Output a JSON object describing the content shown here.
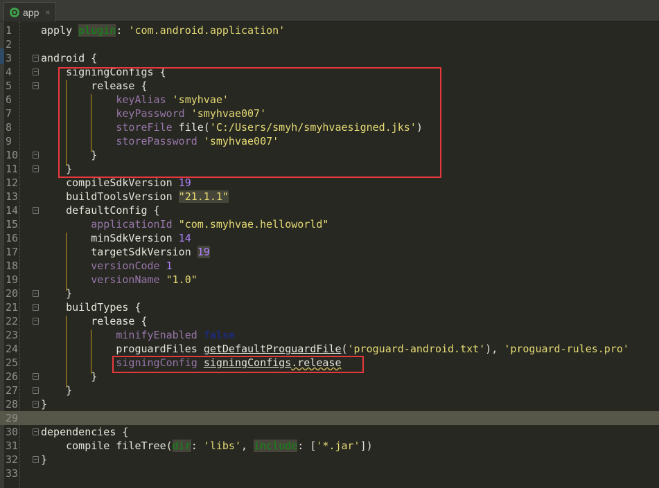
{
  "tab": {
    "label": "app",
    "close": "×",
    "icon": "android-module-icon"
  },
  "colors": {
    "background": "#272822",
    "highlight": "#e8383d",
    "string": "#e6db74",
    "property": "#9876aa",
    "number": "#ae81ff",
    "keyword_arg": "#0f8a16"
  },
  "current_line": 29,
  "code": {
    "lines": [
      {
        "n": "1",
        "fold": false,
        "tokens": [
          {
            "t": "apply "
          },
          {
            "t": "plugin",
            "c": "g bg"
          },
          {
            "t": ": "
          },
          {
            "t": "'com.android.application'",
            "c": "s"
          }
        ]
      },
      {
        "n": "2",
        "fold": false,
        "tokens": []
      },
      {
        "n": "3",
        "fold": true,
        "tokens": [
          {
            "t": "android {"
          }
        ]
      },
      {
        "n": "4",
        "fold": true,
        "tokens": [
          {
            "t": "    signingConfigs {"
          }
        ]
      },
      {
        "n": "5",
        "fold": true,
        "tokens": [
          {
            "t": "        release {"
          }
        ]
      },
      {
        "n": "6",
        "fold": false,
        "tokens": [
          {
            "t": "            "
          },
          {
            "t": "keyAlias",
            "c": "p"
          },
          {
            "t": " "
          },
          {
            "t": "'smyhvae'",
            "c": "s"
          }
        ]
      },
      {
        "n": "7",
        "fold": false,
        "tokens": [
          {
            "t": "            "
          },
          {
            "t": "keyPassword",
            "c": "p"
          },
          {
            "t": " "
          },
          {
            "t": "'smyhvae007'",
            "c": "s"
          }
        ]
      },
      {
        "n": "8",
        "fold": false,
        "tokens": [
          {
            "t": "            "
          },
          {
            "t": "storeFile",
            "c": "p"
          },
          {
            "t": " file("
          },
          {
            "t": "'C:/Users/smyh/smyhvaesigned.jks'",
            "c": "s"
          },
          {
            "t": ")"
          }
        ]
      },
      {
        "n": "9",
        "fold": false,
        "tokens": [
          {
            "t": "            "
          },
          {
            "t": "storePassword",
            "c": "p"
          },
          {
            "t": " "
          },
          {
            "t": "'smyhvae007'",
            "c": "s"
          }
        ]
      },
      {
        "n": "10",
        "fold": true,
        "tokens": [
          {
            "t": "        }"
          }
        ]
      },
      {
        "n": "11",
        "fold": true,
        "tokens": [
          {
            "t": "    }"
          }
        ]
      },
      {
        "n": "12",
        "fold": false,
        "tokens": [
          {
            "t": "    compileSdkVersion "
          },
          {
            "t": "19",
            "c": "n"
          }
        ]
      },
      {
        "n": "13",
        "fold": false,
        "tokens": [
          {
            "t": "    buildToolsVersion "
          },
          {
            "t": "\"21.1.1\"",
            "c": "s bg"
          }
        ]
      },
      {
        "n": "14",
        "fold": true,
        "tokens": [
          {
            "t": "    defaultConfig {"
          }
        ]
      },
      {
        "n": "15",
        "fold": false,
        "tokens": [
          {
            "t": "        "
          },
          {
            "t": "applicationId",
            "c": "p"
          },
          {
            "t": " "
          },
          {
            "t": "\"com.smyhvae.helloworld\"",
            "c": "s"
          }
        ]
      },
      {
        "n": "16",
        "fold": false,
        "tokens": [
          {
            "t": "        minSdkVersion "
          },
          {
            "t": "14",
            "c": "n"
          }
        ]
      },
      {
        "n": "17",
        "fold": false,
        "tokens": [
          {
            "t": "        targetSdkVersion "
          },
          {
            "t": "19",
            "c": "n bg"
          }
        ]
      },
      {
        "n": "18",
        "fold": false,
        "tokens": [
          {
            "t": "        "
          },
          {
            "t": "versionCode",
            "c": "p"
          },
          {
            "t": " "
          },
          {
            "t": "1",
            "c": "n"
          }
        ]
      },
      {
        "n": "19",
        "fold": false,
        "tokens": [
          {
            "t": "        "
          },
          {
            "t": "versionName",
            "c": "p"
          },
          {
            "t": " "
          },
          {
            "t": "\"1.0\"",
            "c": "s"
          }
        ]
      },
      {
        "n": "20",
        "fold": true,
        "tokens": [
          {
            "t": "    }"
          }
        ]
      },
      {
        "n": "21",
        "fold": true,
        "tokens": [
          {
            "t": "    buildTypes {"
          }
        ]
      },
      {
        "n": "22",
        "fold": true,
        "tokens": [
          {
            "t": "        release {"
          }
        ]
      },
      {
        "n": "23",
        "fold": false,
        "tokens": [
          {
            "t": "            "
          },
          {
            "t": "minifyEnabled",
            "c": "p"
          },
          {
            "t": " "
          },
          {
            "t": "false",
            "c": "k"
          }
        ]
      },
      {
        "n": "24",
        "fold": false,
        "tokens": [
          {
            "t": "            proguardFiles "
          },
          {
            "t": "getDefaultProguardFile",
            "c": "u"
          },
          {
            "t": "("
          },
          {
            "t": "'proguard-android.txt'",
            "c": "s"
          },
          {
            "t": "), "
          },
          {
            "t": "'proguard-rules.pro'",
            "c": "s"
          }
        ]
      },
      {
        "n": "25",
        "fold": false,
        "tokens": [
          {
            "t": "            "
          },
          {
            "t": "signingConfig",
            "c": "p"
          },
          {
            "t": " "
          },
          {
            "t": "signingConfigs",
            "c": "u"
          },
          {
            "t": ".release",
            "c": "w"
          }
        ]
      },
      {
        "n": "26",
        "fold": true,
        "tokens": [
          {
            "t": "        }"
          }
        ]
      },
      {
        "n": "27",
        "fold": true,
        "tokens": [
          {
            "t": "    }"
          }
        ]
      },
      {
        "n": "28",
        "fold": true,
        "tokens": [
          {
            "t": "}"
          }
        ]
      },
      {
        "n": "29",
        "fold": false,
        "tokens": []
      },
      {
        "n": "30",
        "fold": true,
        "tokens": [
          {
            "t": "dependencies {"
          }
        ]
      },
      {
        "n": "31",
        "fold": false,
        "tokens": [
          {
            "t": "    compile fileTree("
          },
          {
            "t": "dir",
            "c": "g bg"
          },
          {
            "t": ": "
          },
          {
            "t": "'libs'",
            "c": "s"
          },
          {
            "t": ", "
          },
          {
            "t": "include",
            "c": "g bg"
          },
          {
            "t": ": ["
          },
          {
            "t": "'*.jar'",
            "c": "s"
          },
          {
            "t": "])"
          }
        ]
      },
      {
        "n": "32",
        "fold": true,
        "tokens": [
          {
            "t": "}"
          }
        ]
      },
      {
        "n": "33",
        "fold": false,
        "tokens": []
      }
    ]
  }
}
